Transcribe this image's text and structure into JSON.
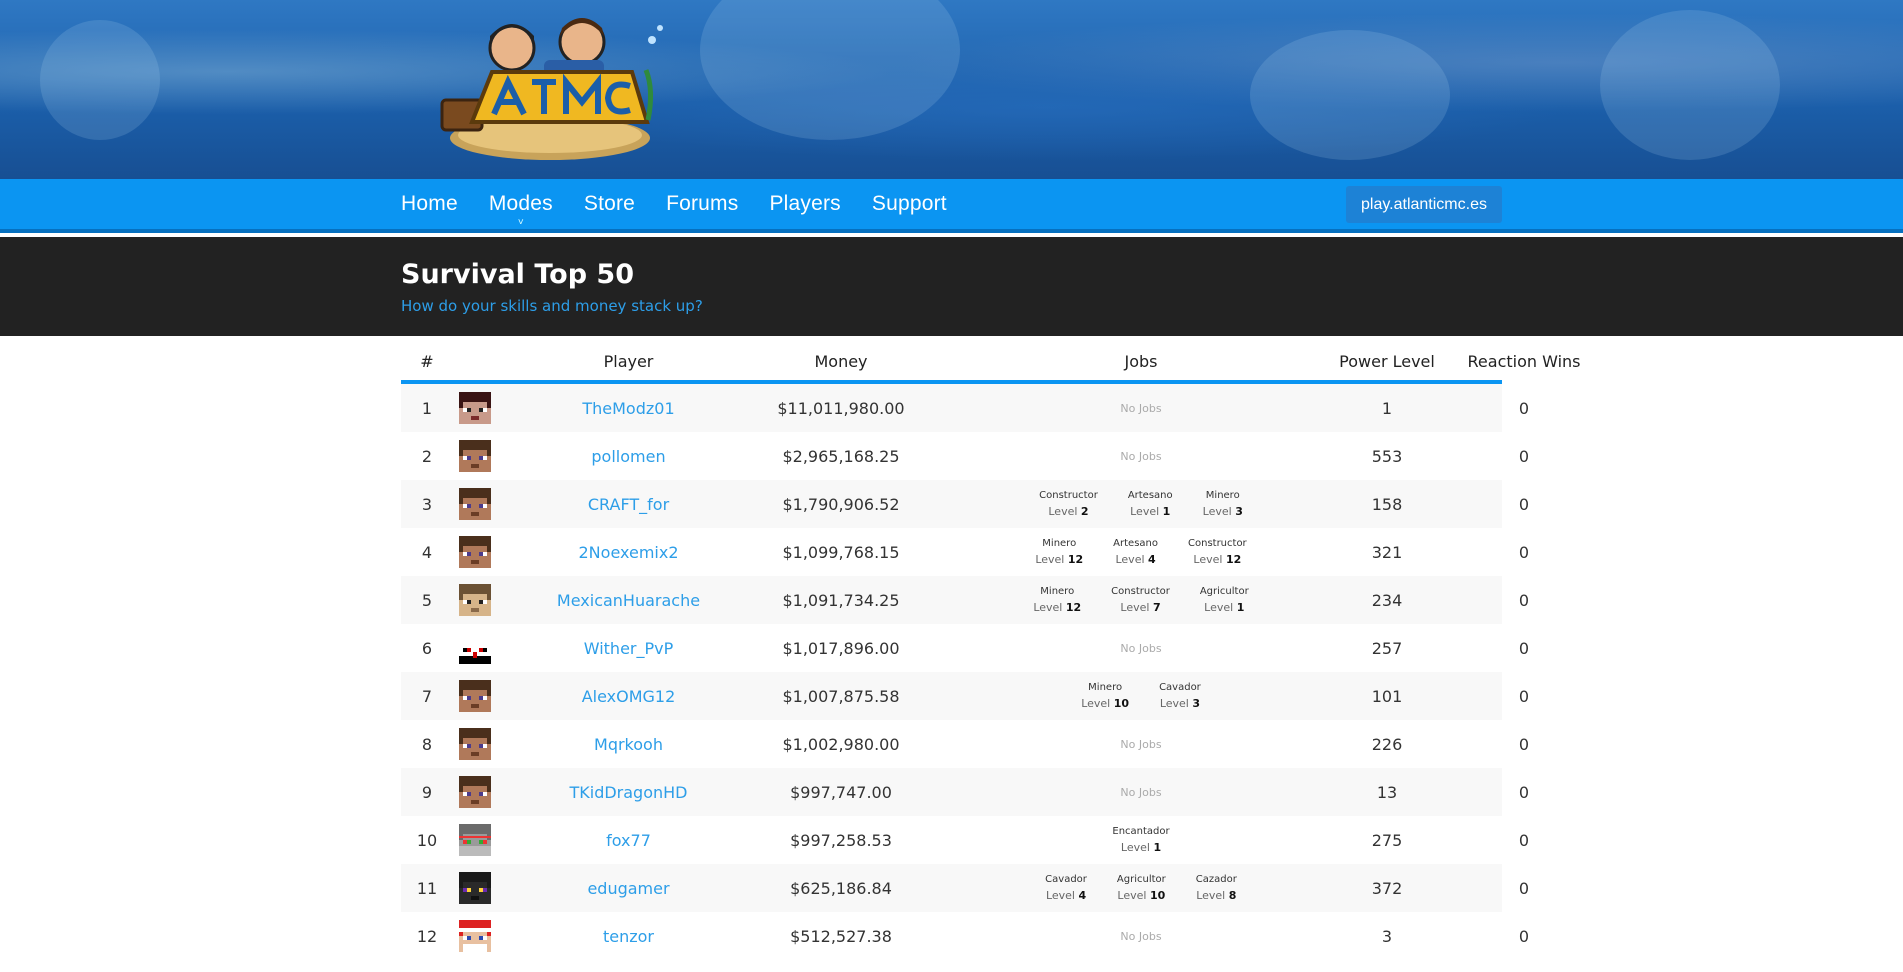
{
  "site": {
    "server_address": "play.atlanticmc.es"
  },
  "nav": {
    "items": [
      {
        "label": "Home",
        "caret": false
      },
      {
        "label": "Modes",
        "caret": true
      },
      {
        "label": "Store",
        "caret": false
      },
      {
        "label": "Forums",
        "caret": false
      },
      {
        "label": "Players",
        "caret": false
      },
      {
        "label": "Support",
        "caret": false
      }
    ]
  },
  "hero": {
    "title": "Survival Top 50",
    "subtitle": "How do your skills and money stack up?"
  },
  "table": {
    "headers": {
      "rank": "#",
      "player": "Player",
      "money": "Money",
      "jobs": "Jobs",
      "power": "Power Level",
      "wins": "Reaction Wins"
    },
    "no_jobs_label": "No Jobs",
    "level_prefix": "Level",
    "rows": [
      {
        "rank": "1",
        "skin": "dark",
        "player": "TheModz01",
        "money": "$11,011,980.00",
        "jobs": [],
        "power": "1",
        "wins": "0"
      },
      {
        "rank": "2",
        "skin": "steve",
        "player": "pollomen",
        "money": "$2,965,168.25",
        "jobs": [],
        "power": "553",
        "wins": "0"
      },
      {
        "rank": "3",
        "skin": "steve",
        "player": "CRAFT_for",
        "money": "$1,790,906.52",
        "jobs": [
          {
            "name": "Constructor",
            "level": "2"
          },
          {
            "name": "Artesano",
            "level": "1"
          },
          {
            "name": "Minero",
            "level": "3"
          }
        ],
        "power": "158",
        "wins": "0"
      },
      {
        "rank": "4",
        "skin": "steve",
        "player": "2Noexemix2",
        "money": "$1,099,768.15",
        "jobs": [
          {
            "name": "Minero",
            "level": "12"
          },
          {
            "name": "Artesano",
            "level": "4"
          },
          {
            "name": "Constructor",
            "level": "12"
          }
        ],
        "power": "321",
        "wins": "0"
      },
      {
        "rank": "5",
        "skin": "tan",
        "player": "MexicanHuarache",
        "money": "$1,091,734.25",
        "jobs": [
          {
            "name": "Minero",
            "level": "12"
          },
          {
            "name": "Constructor",
            "level": "7"
          },
          {
            "name": "Agricultor",
            "level": "1"
          }
        ],
        "power": "234",
        "wins": "0"
      },
      {
        "rank": "6",
        "skin": "white",
        "player": "Wither_PvP",
        "money": "$1,017,896.00",
        "jobs": [],
        "power": "257",
        "wins": "0"
      },
      {
        "rank": "7",
        "skin": "steve",
        "player": "AlexOMG12",
        "money": "$1,007,875.58",
        "jobs": [
          {
            "name": "Minero",
            "level": "10"
          },
          {
            "name": "Cavador",
            "level": "3"
          }
        ],
        "power": "101",
        "wins": "0"
      },
      {
        "rank": "8",
        "skin": "steve",
        "player": "Mqrkooh",
        "money": "$1,002,980.00",
        "jobs": [],
        "power": "226",
        "wins": "0"
      },
      {
        "rank": "9",
        "skin": "steve",
        "player": "TKidDragonHD",
        "money": "$997,747.00",
        "jobs": [],
        "power": "13",
        "wins": "0"
      },
      {
        "rank": "10",
        "skin": "gray",
        "player": "fox77",
        "money": "$997,258.53",
        "jobs": [
          {
            "name": "Encantador",
            "level": "1"
          }
        ],
        "power": "275",
        "wins": "0"
      },
      {
        "rank": "11",
        "skin": "black",
        "player": "edugamer",
        "money": "$625,186.84",
        "jobs": [
          {
            "name": "Cavador",
            "level": "4"
          },
          {
            "name": "Agricultor",
            "level": "10"
          },
          {
            "name": "Cazador",
            "level": "8"
          }
        ],
        "power": "372",
        "wins": "0"
      },
      {
        "rank": "12",
        "skin": "santa",
        "player": "tenzor",
        "money": "$512,527.38",
        "jobs": [],
        "power": "3",
        "wins": "0"
      }
    ]
  },
  "colors": {
    "nav": "#0b95f2",
    "link": "#2d9ee8",
    "hero_bg": "#222222"
  },
  "icons": {
    "logo": "atlanticmc-logo",
    "player_head": "player-head-icon"
  }
}
